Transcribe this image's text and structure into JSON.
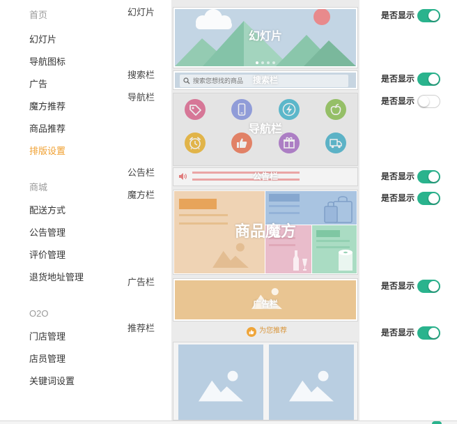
{
  "sidebar": {
    "sections": [
      {
        "title": "首页",
        "items": [
          {
            "label": "幻灯片",
            "active": false
          },
          {
            "label": "导航图标",
            "active": false
          },
          {
            "label": "广告",
            "active": false
          },
          {
            "label": "魔方推荐",
            "active": false
          },
          {
            "label": "商品推荐",
            "active": false
          },
          {
            "label": "排版设置",
            "active": true
          }
        ]
      },
      {
        "title": "商城",
        "items": [
          {
            "label": "配送方式",
            "active": false
          },
          {
            "label": "公告管理",
            "active": false
          },
          {
            "label": "评价管理",
            "active": false
          },
          {
            "label": "退货地址管理",
            "active": false
          }
        ]
      },
      {
        "title": "O2O",
        "items": [
          {
            "label": "门店管理",
            "active": false
          },
          {
            "label": "店员管理",
            "active": false
          },
          {
            "label": "关键词设置",
            "active": false
          }
        ]
      }
    ]
  },
  "rows": [
    {
      "label": "幻灯片",
      "toggle_label": "是否显示",
      "shown": true
    },
    {
      "label": "搜索栏",
      "toggle_label": "是否显示",
      "shown": true
    },
    {
      "label": "导航栏",
      "toggle_label": "是否显示",
      "shown": false
    },
    {
      "label": "公告栏",
      "toggle_label": "是否显示",
      "shown": true
    },
    {
      "label": "魔方栏",
      "toggle_label": "是否显示",
      "shown": true
    },
    {
      "label": "广告栏",
      "toggle_label": "是否显示",
      "shown": true
    },
    {
      "label": "推荐栏",
      "toggle_label": "是否显示",
      "shown": true
    }
  ],
  "preview": {
    "slideshow": {
      "label": "幻灯片",
      "slides": 4,
      "active_slide": 1
    },
    "search": {
      "placeholder": "搜索您想找的商品",
      "label": "搜索栏",
      "icon": "search-icon"
    },
    "nav": {
      "label": "导航栏",
      "icons": [
        {
          "icon": "tag-icon",
          "color": "#e05c88"
        },
        {
          "icon": "phone-icon",
          "color": "#7f8fe2"
        },
        {
          "icon": "lightning-icon",
          "color": "#37b5cf"
        },
        {
          "icon": "apple-icon",
          "color": "#86bf46"
        },
        {
          "icon": "alarm-clock-icon",
          "color": "#efb01d"
        },
        {
          "icon": "thumbs-up-icon",
          "color": "#ef6a45"
        },
        {
          "icon": "gift-icon",
          "color": "#a566c6"
        },
        {
          "icon": "truck-icon",
          "color": "#36adc9"
        }
      ]
    },
    "notice": {
      "label": "公告栏",
      "icon": "speaker-icon"
    },
    "cube": {
      "label": "商品魔方"
    },
    "ad": {
      "label": "广告栏"
    },
    "recommend": {
      "title": "为您推荐",
      "icon": "thumbs-up-icon"
    }
  },
  "colors": {
    "accent": "#f0a030",
    "toggle_on": "#2ab38d"
  }
}
